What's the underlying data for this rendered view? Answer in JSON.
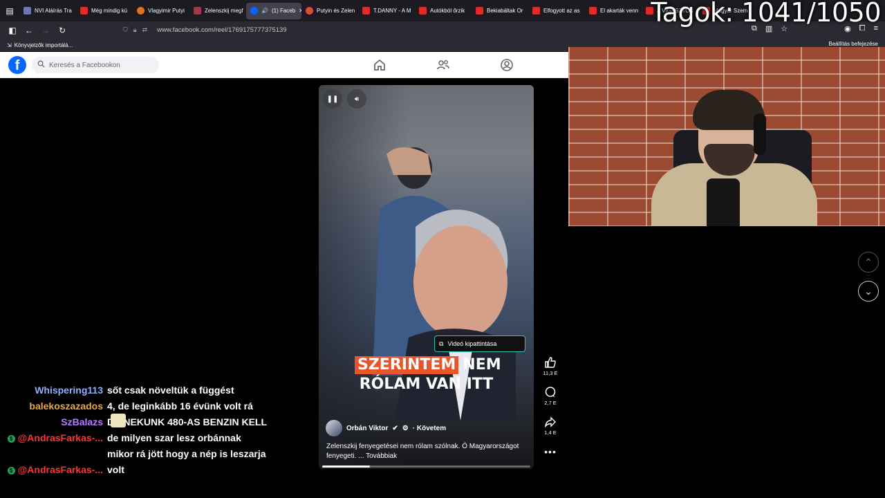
{
  "overlay": {
    "members_label": "Tagok: 1041/1050"
  },
  "browser": {
    "tabs": [
      {
        "label": "NVI Aláírás Tra",
        "color": "#6f76b8"
      },
      {
        "label": "Még mindig kü",
        "color": "#e02b2b"
      },
      {
        "label": "Vlagyimir Putyi",
        "color": "#e3701c"
      },
      {
        "label": "Zelenszkij megf",
        "color": "#9b3a4a"
      },
      {
        "label": "(1) Faceb",
        "color": "#0866ff"
      },
      {
        "label": "Putyin és Zelen",
        "color": "#e04b3a"
      },
      {
        "label": "T.DANNY - A M",
        "color": "#e02b2b"
      },
      {
        "label": "Autókból őrzik",
        "color": "#e02b2b"
      },
      {
        "label": "Bekiabáltak Or",
        "color": "#e02b2b"
      },
      {
        "label": "Elfogyott az as",
        "color": "#e02b2b"
      },
      {
        "label": "El akarták venn",
        "color": "#e02b2b"
      },
      {
        "label": "A VIGASZTOS",
        "color": "#e02b2b"
      },
      {
        "label": "Magyar Szem",
        "color": "#e02b2b"
      }
    ],
    "url": "www.facebook.com/reel/1769175777375139",
    "bookmark": "Könyvjelzők importálá...",
    "bookmark_right": "Beállítás befejezése"
  },
  "facebook": {
    "logo_letter": "f",
    "search_placeholder": "Keresés a Facebookon"
  },
  "reel": {
    "caption_highlight": "SZERINTEM",
    "caption_rest": "NEM",
    "caption_line2": "RÓLAM VAN ITT",
    "pip_label": "Videó kipattintása",
    "author": "Orbán Viktor",
    "follow": "· Követem",
    "description": "Zelenszkij fenyegetései nem rólam szólnak. Ó Magyarországot fenyegeti. ... Továbbiak",
    "progress": 0.23,
    "likes": "11,3 E",
    "comments": "2,7 E",
    "shares": "1,4 E"
  },
  "chat": [
    {
      "user": "Whispering113",
      "color": "#8fb2ff",
      "text": "sőt csak növeltük a függést"
    },
    {
      "user": "balekoszazados",
      "color": "#e8a84a",
      "text": "4, de leginkább 16 évünk volt rá"
    },
    {
      "user": "",
      "color": "#ffffff",
      "text": ""
    },
    {
      "user": "SzBalazs",
      "color": "#b77cff",
      "text": "DE NEKUNK 480-AS BENZIN KELL"
    },
    {
      "user": "@AndrasFarkas-...",
      "color": "#ff3333",
      "text": "de milyen szar lesz orbánnak"
    },
    {
      "user": "",
      "color": "#ffffff",
      "text": "mikor rá jött hogy a nép is leszarja"
    },
    {
      "user": "@AndrasFarkas-...",
      "color": "#ff3333",
      "text": "volt"
    }
  ]
}
